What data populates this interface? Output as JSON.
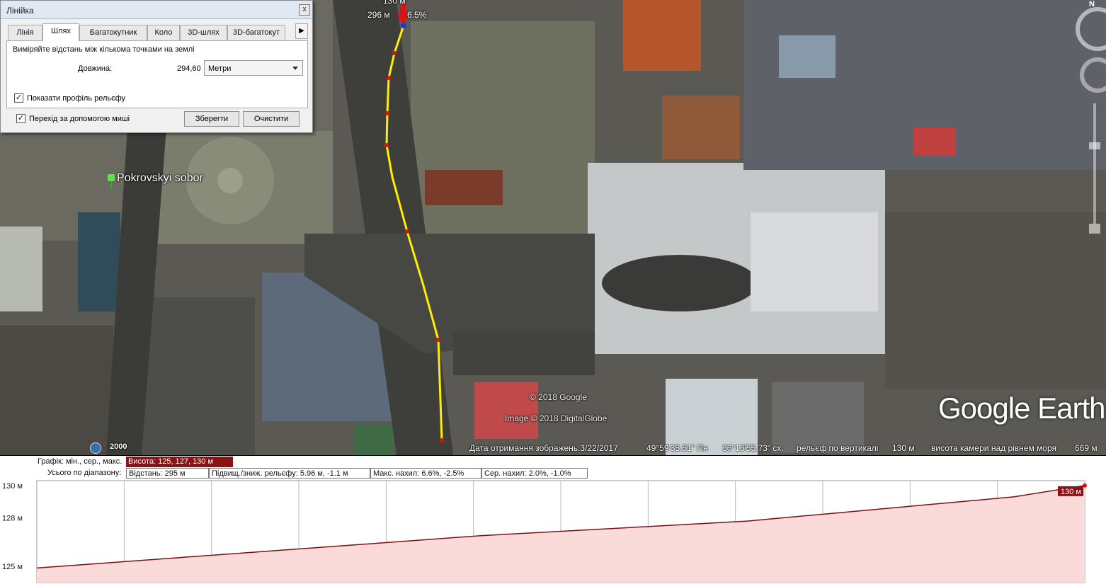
{
  "map": {
    "place_label": "Pokrovskyi sobor",
    "copyright_google": "© 2018 Google",
    "copyright_image": "Image © 2018 DigitalGlobe",
    "logo": "Google Earth",
    "marker_top": "130 м",
    "marker_distance": "296 м",
    "marker_slope": "6.5%",
    "north": "N",
    "colors": {
      "path": "#ffee00",
      "path_nodes": "#e01010",
      "marker": "#e01010"
    }
  },
  "status": {
    "time_year": "2000",
    "date_label": "Дата отримання зображень:3/22/2017",
    "lat": "49°59'35.51\" Пн",
    "lon": "36°13'55.73\" сх.",
    "relief_label": "рельєф по вертикалі",
    "relief_value": "130 м",
    "camera_label": "висота камери над рівнем моря",
    "camera_value": "669 м"
  },
  "ruler": {
    "title": "Лінійка",
    "close": "x",
    "tabs": [
      {
        "label": "Лінія",
        "active": false
      },
      {
        "label": "Шлях",
        "active": true
      },
      {
        "label": "Багатокутник",
        "active": false
      },
      {
        "label": "Коло",
        "active": false
      },
      {
        "label": "3D-шлях",
        "active": false
      },
      {
        "label": "3D-багатокут",
        "active": false
      }
    ],
    "tab_scroll": "▶",
    "instruction": "Виміряйте відстань між кількома точками на землі",
    "length_label": "Довжина:",
    "length_value": "294,60",
    "units": "Метри",
    "relief_profile_label": "Показати профіль рельєфу",
    "relief_profile_checked": true,
    "mouse_nav_label": "Перехід за допомогою миші",
    "mouse_nav_checked": true,
    "save": "Зберегти",
    "clear": "Очистити"
  },
  "profile": {
    "graph_label": "Графік: мін., сер., макс.",
    "graph_value": "Висота: 125, 127, 130 м",
    "range_label": "Усього по діапазону:",
    "distance": "Відстань: 295 м",
    "elevation_change": "Підвищ./зниж. рельєфу: 5.96 м, -1.1 м",
    "max_slope": "Макс. нахил: 6.6%, -2.5%",
    "avg_slope": "Сер. нахил: 2.0%, -1.0%",
    "y_ticks": [
      "130 м",
      "128 м",
      "125 м"
    ],
    "end_label": "130 м",
    "colors": {
      "line": "#7a1010",
      "fill": "#fbdada"
    }
  },
  "chart_data": {
    "type": "area",
    "x_unit": "м",
    "y_unit": "м",
    "x": [
      0,
      25,
      50,
      75,
      100,
      125,
      150,
      175,
      200,
      225,
      250,
      275,
      295
    ],
    "y": [
      124.9,
      125.3,
      125.7,
      126.1,
      126.5,
      126.9,
      127.2,
      127.5,
      127.8,
      128.3,
      128.8,
      129.3,
      130.0
    ],
    "ylim": [
      124,
      130.3
    ],
    "xlim": [
      0,
      295
    ],
    "y_tick_values": [
      130,
      128,
      125
    ]
  }
}
